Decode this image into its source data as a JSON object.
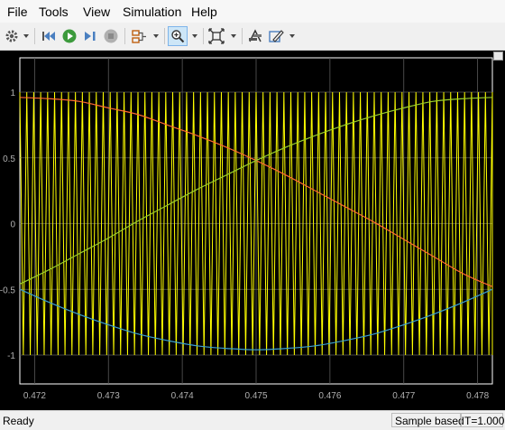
{
  "menu": [
    "File",
    "Tools",
    "View",
    "Simulation",
    "Help"
  ],
  "toolbar": {
    "icons": [
      "gear-icon",
      "rewind-icon",
      "run-icon",
      "step-forward-icon",
      "stop-icon",
      "signal-select-icon",
      "zoom-in-icon",
      "fit-to-view-icon",
      "cursor-measure-icon",
      "style-edit-icon"
    ]
  },
  "status": {
    "state": "Ready",
    "mode": "Sample based",
    "time": "T=1.000"
  },
  "colors": {
    "background": "#000000",
    "grid": "#5a5a5a",
    "axes": "#ffffff",
    "ticks": "#b0b0b0",
    "yellow": "#ffff00",
    "orange": "#ff6a30",
    "green": "#9ad02a",
    "cyan": "#3aa0d0"
  },
  "chart_data": {
    "type": "line",
    "title": "",
    "xlabel": "",
    "ylabel": "",
    "xlim": [
      0.4718,
      0.4782
    ],
    "ylim": [
      -1.0,
      1.0
    ],
    "x_ticks": [
      "0.472",
      "0.473",
      "0.474",
      "0.475",
      "0.476",
      "0.477",
      "0.478"
    ],
    "y_ticks": [
      "1",
      "0.5",
      "0",
      "-0.5",
      "-1"
    ],
    "grid": true,
    "series": [
      {
        "color": "#ffff00",
        "description_values": {
          "kind": "triangle-carrier",
          "min": -1,
          "max": 1,
          "periods_in_view": 68
        }
      },
      {
        "color": "#ff6a30",
        "x": [
          0.4718,
          0.4722,
          0.4726,
          0.473,
          0.4734,
          0.4738,
          0.4742,
          0.4746,
          0.475,
          0.4754,
          0.4758,
          0.4762,
          0.4766,
          0.477,
          0.4774,
          0.4778,
          0.4782
        ],
        "y": [
          0.96,
          0.95,
          0.93,
          0.88,
          0.83,
          0.75,
          0.67,
          0.58,
          0.48,
          0.37,
          0.25,
          0.13,
          0.01,
          -0.12,
          -0.25,
          -0.38,
          -0.48
        ]
      },
      {
        "color": "#9ad02a",
        "x": [
          0.4718,
          0.4722,
          0.4726,
          0.473,
          0.4734,
          0.4738,
          0.4742,
          0.4746,
          0.475,
          0.4754,
          0.4758,
          0.4762,
          0.4766,
          0.477,
          0.4774,
          0.4778,
          0.4782
        ],
        "y": [
          -0.46,
          -0.35,
          -0.23,
          -0.11,
          0.02,
          0.14,
          0.26,
          0.37,
          0.48,
          0.58,
          0.67,
          0.75,
          0.82,
          0.88,
          0.93,
          0.95,
          0.96
        ]
      },
      {
        "color": "#3aa0d0",
        "x": [
          0.4718,
          0.4722,
          0.4726,
          0.473,
          0.4734,
          0.4738,
          0.4742,
          0.4746,
          0.475,
          0.4754,
          0.4758,
          0.4762,
          0.4766,
          0.477,
          0.4774,
          0.4778,
          0.4782
        ],
        "y": [
          -0.5,
          -0.6,
          -0.69,
          -0.77,
          -0.84,
          -0.89,
          -0.93,
          -0.95,
          -0.96,
          -0.95,
          -0.93,
          -0.89,
          -0.84,
          -0.77,
          -0.69,
          -0.6,
          -0.5
        ]
      }
    ]
  }
}
